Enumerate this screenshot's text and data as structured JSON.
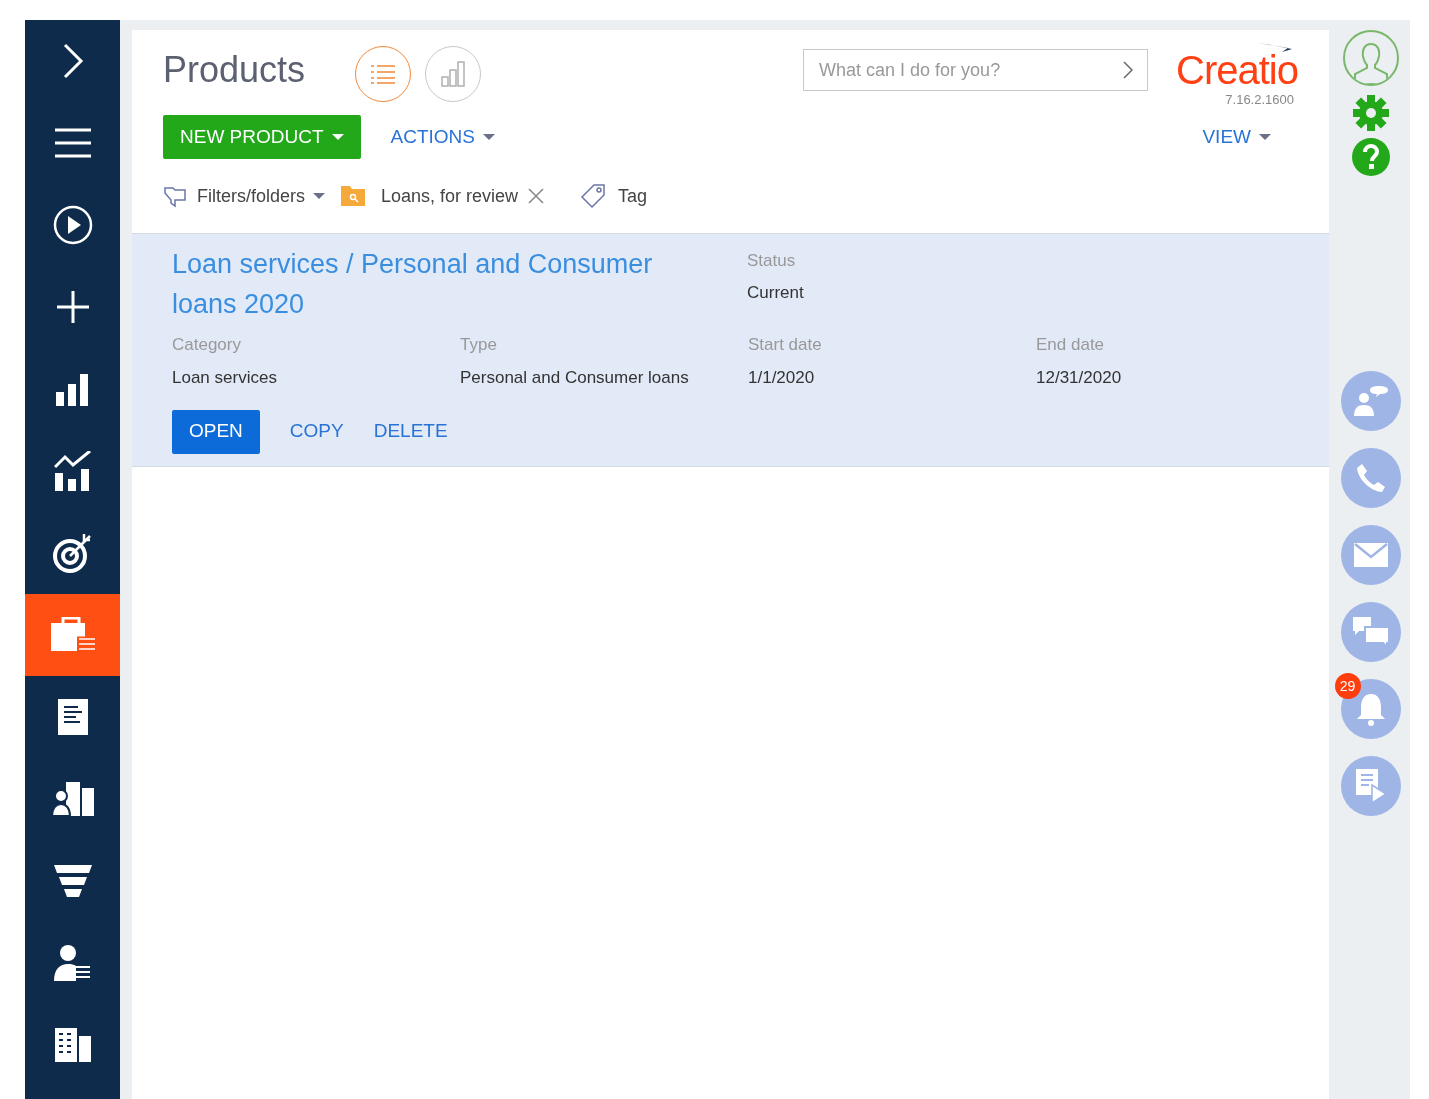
{
  "sidebar": {
    "items": [
      {
        "kind": "expand",
        "selected": false
      },
      {
        "kind": "menu",
        "selected": false
      },
      {
        "kind": "play",
        "selected": false
      },
      {
        "kind": "add",
        "selected": false
      },
      {
        "kind": "bars",
        "selected": false
      },
      {
        "kind": "trend",
        "selected": false
      },
      {
        "kind": "target",
        "selected": false
      },
      {
        "kind": "briefcase",
        "selected": true
      },
      {
        "kind": "document",
        "selected": false
      },
      {
        "kind": "contacts",
        "selected": false
      },
      {
        "kind": "funnel",
        "selected": false
      },
      {
        "kind": "person",
        "selected": false
      },
      {
        "kind": "building",
        "selected": false
      }
    ]
  },
  "header": {
    "title": "Products",
    "views": [
      {
        "kind": "list",
        "selected": true
      },
      {
        "kind": "chart",
        "selected": false
      }
    ],
    "search": {
      "placeholder": "What can I do for you?"
    },
    "logo": "Creatio",
    "version": "7.16.2.1600"
  },
  "toolbar": {
    "primary": "NEW PRODUCT",
    "actions": "ACTIONS",
    "view": "VIEW"
  },
  "filters": {
    "filters_folders": "Filters/folders",
    "folder": "Loans, for review",
    "tag": "Tag"
  },
  "record": {
    "title": "Loan services / Personal and Consumer loans 2020",
    "status": {
      "label": "Status",
      "value": "Current"
    },
    "fields": [
      {
        "label": "Category",
        "value": "Loan services"
      },
      {
        "label": "Type",
        "value": "Personal and Consumer loans"
      },
      {
        "label": "Start date",
        "value": "1/1/2020"
      },
      {
        "label": "End date",
        "value": "12/31/2020"
      }
    ],
    "buttons": [
      {
        "label": "OPEN",
        "kind": "primary"
      },
      {
        "label": "COPY",
        "kind": "link"
      },
      {
        "label": "DELETE",
        "kind": "link"
      }
    ]
  },
  "right_panel": {
    "comms": [
      {
        "kind": "agent"
      },
      {
        "kind": "phone"
      },
      {
        "kind": "email"
      },
      {
        "kind": "chat"
      },
      {
        "kind": "bell",
        "badge": "29"
      },
      {
        "kind": "feed"
      }
    ]
  }
}
